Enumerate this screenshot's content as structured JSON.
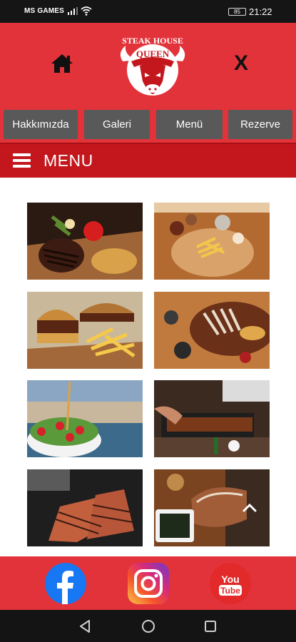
{
  "status_bar": {
    "carrier": "MS GAMES",
    "battery": "85",
    "time": "21:22"
  },
  "header": {
    "logo_text_top": "STEAK HOUSE",
    "logo_text_main": "QUEEN",
    "close_label": "X",
    "home_icon": "home-icon"
  },
  "nav": {
    "items": [
      {
        "label": "Hakkımızda"
      },
      {
        "label": "Galeri"
      },
      {
        "label": "Menü"
      },
      {
        "label": "Rezerve"
      }
    ]
  },
  "menu_bar": {
    "title": "MENU",
    "icon": "hamburger-icon"
  },
  "gallery": {
    "items": [
      {
        "description_icon": "steak-plate-photo"
      },
      {
        "description_icon": "fries-board-photo"
      },
      {
        "description_icon": "burger-fries-photo"
      },
      {
        "description_icon": "lamb-chops-photo"
      },
      {
        "description_icon": "salad-bowl-photo"
      },
      {
        "description_icon": "chef-grill-photo"
      },
      {
        "description_icon": "grilling-steaks-photo"
      },
      {
        "description_icon": "tbone-steak-photo"
      }
    ]
  },
  "social": {
    "facebook": "facebook-icon",
    "instagram": "instagram-icon",
    "youtube_line1": "You",
    "youtube_line2": "Tube"
  },
  "colors": {
    "brand_red": "#e2333a",
    "dark_red": "#c3171d",
    "nav_grey": "#595959"
  }
}
